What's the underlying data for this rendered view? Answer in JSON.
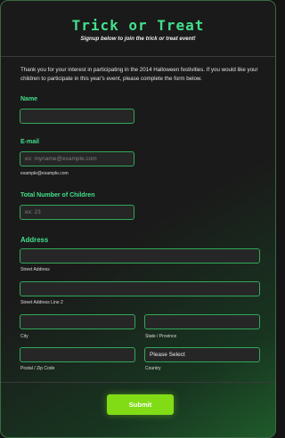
{
  "header": {
    "title": "Trick or Treat",
    "subtitle": "Signup below to join the trick or treat event!"
  },
  "intro": "Thank you for your interest in participating in the 2014 Halloween festivities. If you would like your children to participate in this year's event, please complete the form below.",
  "fields": {
    "name": {
      "label": "Name",
      "value": ""
    },
    "email": {
      "label": "E-mail",
      "placeholder": "ex: myname@example.com",
      "hint": "example@example.com"
    },
    "children": {
      "label": "Total Number of Children",
      "placeholder": "ex: 23"
    },
    "address": {
      "label": "Address",
      "street_hint": "Street Address",
      "street2_hint": "Street Address Line 2",
      "city_hint": "City",
      "state_hint": "State / Province",
      "postal_hint": "Postal / Zip Code",
      "country_hint": "Country",
      "country_value": "Please Select"
    }
  },
  "submit_label": "Submit",
  "colors": {
    "accent": "#43e08c",
    "input_border": "#31a85a",
    "button": "#81dc16",
    "background": "#1a1a1a"
  }
}
